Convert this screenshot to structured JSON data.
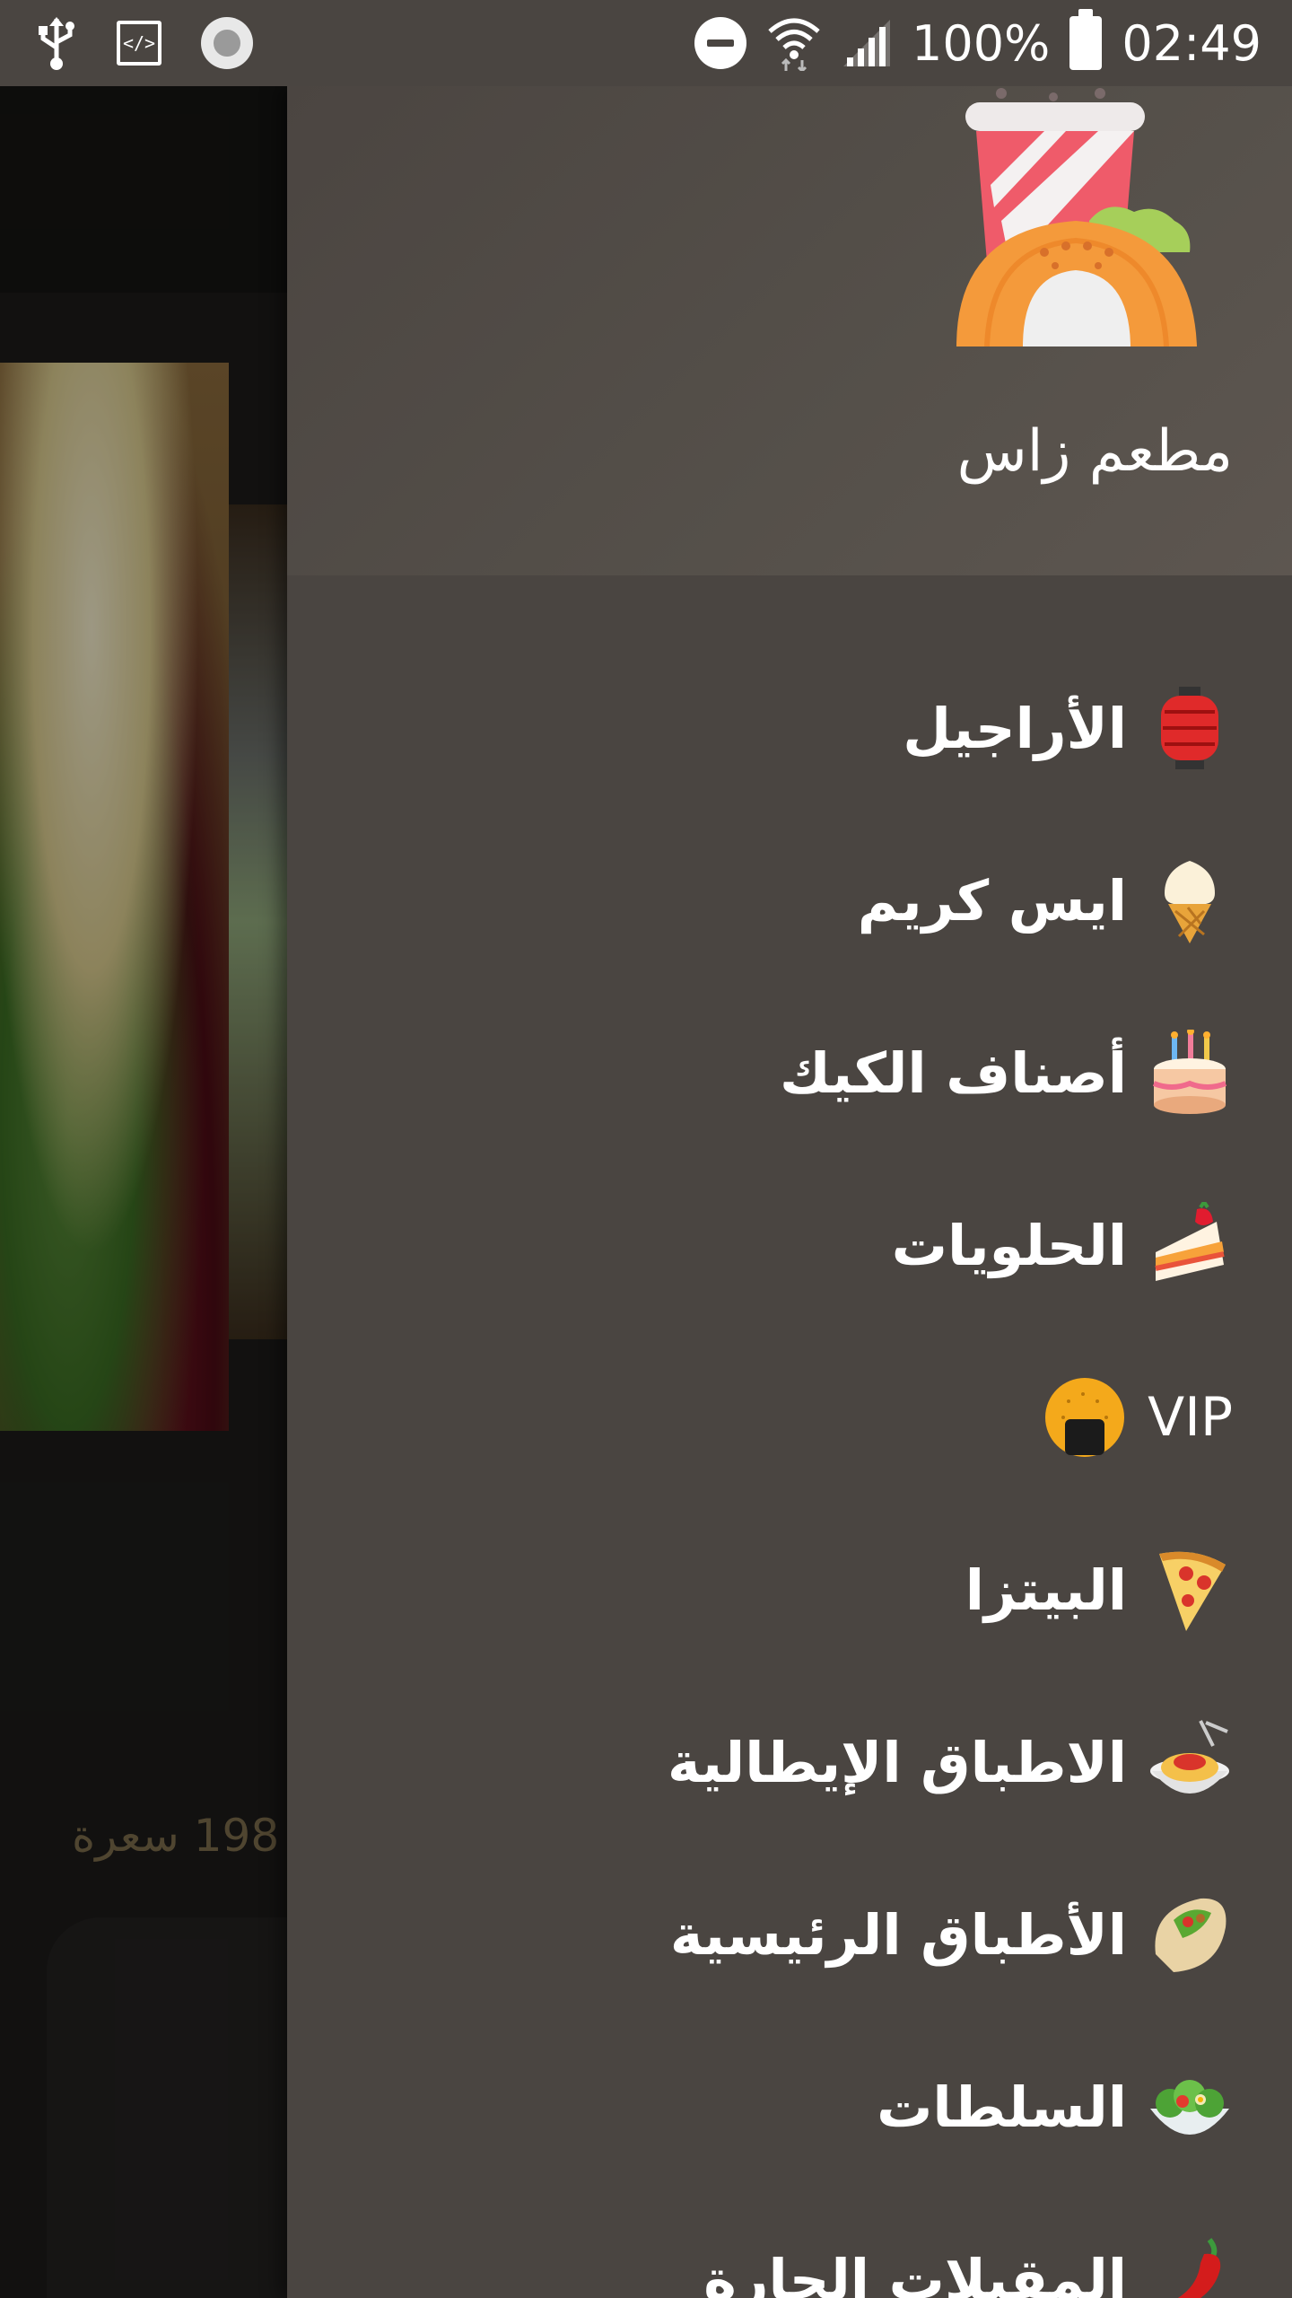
{
  "status_bar": {
    "battery_text": "100%",
    "time": "02:49",
    "left_icons": [
      "usb-icon",
      "developer-mode-icon",
      "screen-record-icon"
    ],
    "right_icons": [
      "do-not-disturb-icon",
      "wifi-icon",
      "signal-icon",
      "battery-icon"
    ]
  },
  "background": {
    "price_text": "198 سعرة"
  },
  "drawer": {
    "restaurant_name": "مطعم زاس",
    "items": [
      {
        "label": "الأراجيل",
        "icon": "red-lantern-icon"
      },
      {
        "label": "ايس كريم",
        "icon": "ice-cream-cone-icon"
      },
      {
        "label": "أصناف الكيك",
        "icon": "birthday-cake-icon"
      },
      {
        "label": "الحلويات",
        "icon": "shortcake-slice-icon"
      },
      {
        "label": "VIP",
        "icon": "rice-ball-icon"
      },
      {
        "label": "البيتزا",
        "icon": "pizza-slice-icon"
      },
      {
        "label": "الاطباق الإيطالية",
        "icon": "spaghetti-icon"
      },
      {
        "label": "الأطباق الرئيسية",
        "icon": "stuffed-flatbread-icon"
      },
      {
        "label": "السلطات",
        "icon": "green-salad-icon"
      },
      {
        "label": "المقبلات الحارة",
        "icon": "hot-pepper-icon"
      }
    ]
  },
  "colors": {
    "drawer_bg": "#4a4541",
    "status_bar_bg": "#4a4541",
    "background_price": "#7a6a4a"
  }
}
